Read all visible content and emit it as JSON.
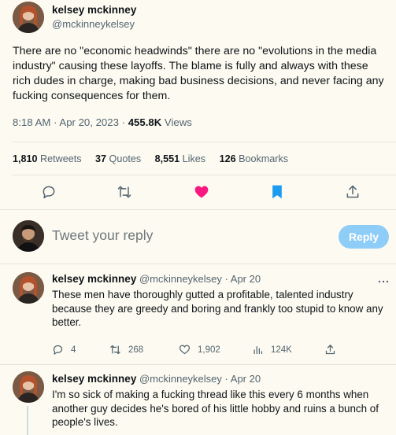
{
  "tweet": {
    "author_name": "kelsey mckinney",
    "author_handle": "@mckinneykelsey",
    "text": "There are no \"economic headwinds\" there are no \"evolutions in the media industry\" causing these layoffs. The blame is fully and always with these rich dudes in charge, making bad business decisions, and never facing any fucking consequences for them.",
    "time": "8:18 AM",
    "separator": "·",
    "date": "Apr 20, 2023",
    "views_count": "455.8K",
    "views_label": "Views"
  },
  "stats": {
    "retweets_count": "1,810",
    "retweets_label": "Retweets",
    "quotes_count": "37",
    "quotes_label": "Quotes",
    "likes_count": "8,551",
    "likes_label": "Likes",
    "bookmarks_count": "126",
    "bookmarks_label": "Bookmarks"
  },
  "actions": {
    "icons": [
      "reply-icon",
      "retweet-icon",
      "like-icon",
      "bookmark-icon",
      "share-icon"
    ],
    "like_color": "#f91880",
    "bookmark_color": "#1d9bf0"
  },
  "composer": {
    "placeholder": "Tweet your reply",
    "reply_button": "Reply",
    "reply_button_color": "#8ecdf7"
  },
  "replies": [
    {
      "author_name": "kelsey mckinney",
      "author_handle": "@mckinneykelsey",
      "separator": "·",
      "date": "Apr 20",
      "text": "These men have thoroughly gutted a profitable, talented industry because they are greedy and boring and frankly too stupid to know any better.",
      "reply_count": "4",
      "retweet_count": "268",
      "like_count": "1,902",
      "views_count": "124K"
    },
    {
      "author_name": "kelsey mckinney",
      "author_handle": "@mckinneykelsey",
      "separator": "·",
      "date": "Apr 20",
      "text": "I'm so sick of making a fucking thread like this every 6 months when another guy decides he's bored of his little hobby and ruins a bunch of people's lives."
    }
  ]
}
